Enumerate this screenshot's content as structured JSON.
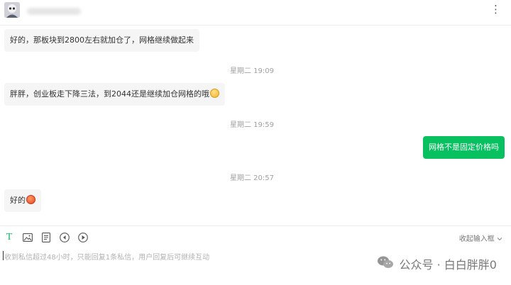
{
  "header": {
    "more_icon": "more-dots-icon",
    "more_label": "⋮"
  },
  "messages": [
    {
      "direction": "in",
      "text": "好的，那板块到2800左右就加仓了，网格继续做起来"
    },
    {
      "time": "星期二 19:09"
    },
    {
      "direction": "in",
      "text": "胖胖，创业板走下降三法，到2044还是继续加仓网格的哦",
      "emoji": "grinning-emoji"
    },
    {
      "time": "星期二 19:59"
    },
    {
      "direction": "out",
      "text": "网格不是固定价格吗"
    },
    {
      "time": "星期二 20:57"
    },
    {
      "direction": "in",
      "text": "好的",
      "emoji": "rose-emoji"
    }
  ],
  "composer": {
    "tools": [
      "text-format-icon",
      "image-icon",
      "document-icon",
      "audio-icon",
      "video-play-icon"
    ],
    "text_tool_label": "T",
    "collapse_label": "收起输入框",
    "hint": "收到私信超过48小时，只能回复1条私信，用户回复后可继续互动"
  },
  "watermark": {
    "text": "公众号 · 白白胖胖0"
  },
  "colors": {
    "accent": "#07c160",
    "incoming_bubble": "#f5f5f5"
  }
}
